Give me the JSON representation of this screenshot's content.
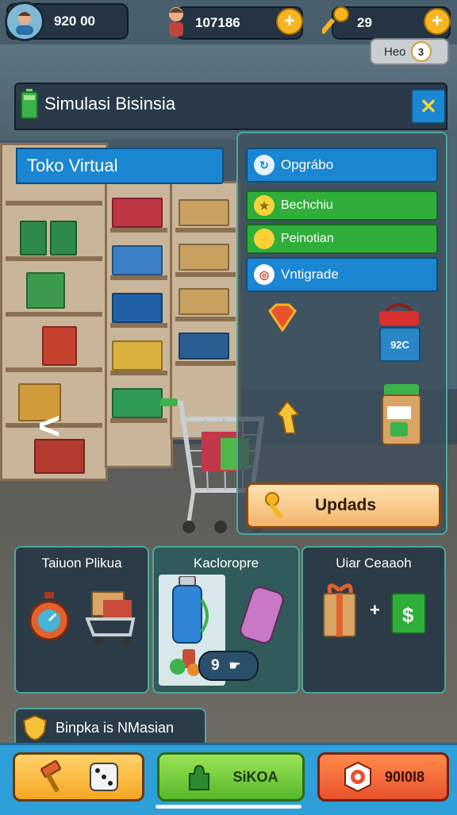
{
  "hud": {
    "coins": "920 00",
    "gems": "107186",
    "keys": "29",
    "badge": "Heo",
    "badge_count": "3"
  },
  "window": {
    "title": "Simulasi Bisinsia",
    "close_label": "✕"
  },
  "store": {
    "label": "Toko Virtual",
    "price_tag": "92C",
    "back_arrow": "<"
  },
  "menu": [
    {
      "label": "Opgrábo",
      "style": "blue"
    },
    {
      "label": "Bechchiu",
      "style": "green"
    },
    {
      "label": "Peinotian",
      "style": "green"
    },
    {
      "label": "Vntigrade",
      "style": "blue"
    }
  ],
  "update_button": {
    "label": "Updads"
  },
  "cards": [
    {
      "title": "Taiuon Plikua"
    },
    {
      "title": "Kacloropre",
      "counter": "9"
    },
    {
      "title": "Uiar Ceaaoh",
      "plus": "+"
    }
  ],
  "hint": {
    "label": "Binpka is NMasian"
  },
  "bottom_bar": [
    {
      "label": ""
    },
    {
      "label": "SiKOA"
    },
    {
      "label": "90I0I8"
    }
  ],
  "colors": {
    "accent_blue": "#1b86d2",
    "accent_green": "#2fae3a",
    "gold": "#f6b523",
    "panel": "#2b3b47"
  }
}
